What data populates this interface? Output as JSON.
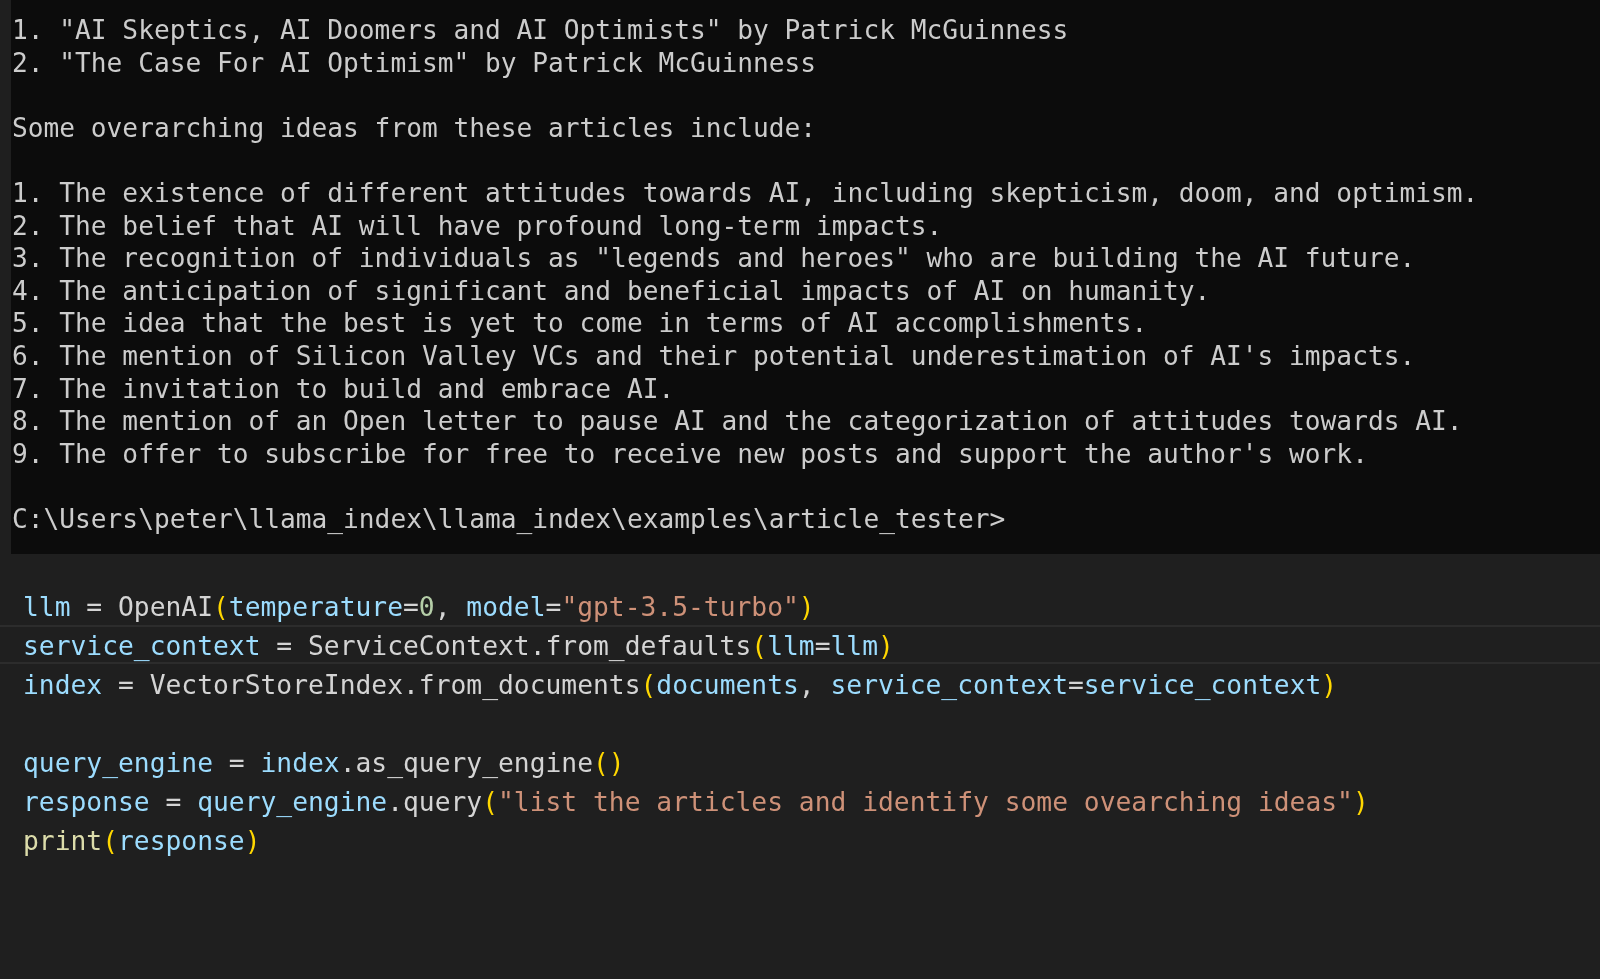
{
  "terminal": {
    "paragraphs": [
      {
        "lines": [
          "1. \"AI Skeptics, AI Doomers and AI Optimists\" by Patrick McGuinness",
          "2. \"The Case For AI Optimism\" by Patrick McGuinness"
        ]
      },
      {
        "lines": [
          "Some overarching ideas from these articles include:"
        ]
      },
      {
        "lines": [
          "1. The existence of different attitudes towards AI, including skepticism, doom, and optimism.",
          "2. The belief that AI will have profound long-term impacts.",
          "3. The recognition of individuals as \"legends and heroes\" who are building the AI future.",
          "4. The anticipation of significant and beneficial impacts of AI on humanity.",
          "5. The idea that the best is yet to come in terms of AI accomplishments.",
          "6. The mention of Silicon Valley VCs and their potential underestimation of AI's impacts.",
          "7. The invitation to build and embrace AI.",
          "8. The mention of an Open letter to pause AI and the categorization of attitudes towards AI.",
          "9. The offer to subscribe for free to receive new posts and support the author's work."
        ]
      },
      {
        "lines": [
          "C:\\Users\\peter\\llama_index\\llama_index\\examples\\article_tester>"
        ]
      }
    ]
  },
  "editor": {
    "blocks": [
      {
        "lines": [
          {
            "current": false,
            "tokens": [
              {
                "kind": "var",
                "text": "llm"
              },
              {
                "kind": "op",
                "text": " = "
              },
              {
                "kind": "plain",
                "text": "OpenAI"
              },
              {
                "kind": "paren",
                "text": "("
              },
              {
                "kind": "var",
                "text": "temperature"
              },
              {
                "kind": "op",
                "text": "="
              },
              {
                "kind": "num",
                "text": "0"
              },
              {
                "kind": "op",
                "text": ", "
              },
              {
                "kind": "var",
                "text": "model"
              },
              {
                "kind": "op",
                "text": "="
              },
              {
                "kind": "str",
                "text": "\"gpt-3.5-turbo\""
              },
              {
                "kind": "paren",
                "text": ")"
              }
            ]
          },
          {
            "current": true,
            "tokens": [
              {
                "kind": "var",
                "text": "service_context"
              },
              {
                "kind": "op",
                "text": " = "
              },
              {
                "kind": "plain",
                "text": "ServiceContext.from_defaults"
              },
              {
                "kind": "paren",
                "text": "("
              },
              {
                "kind": "var",
                "text": "llm"
              },
              {
                "kind": "op",
                "text": "="
              },
              {
                "kind": "var",
                "text": "llm"
              },
              {
                "kind": "paren",
                "text": ")"
              }
            ]
          },
          {
            "current": false,
            "tokens": [
              {
                "kind": "var",
                "text": "index"
              },
              {
                "kind": "op",
                "text": " = "
              },
              {
                "kind": "plain",
                "text": "VectorStoreIndex.from_documents"
              },
              {
                "kind": "paren",
                "text": "("
              },
              {
                "kind": "var",
                "text": "documents"
              },
              {
                "kind": "op",
                "text": ", "
              },
              {
                "kind": "var",
                "text": "service_context"
              },
              {
                "kind": "op",
                "text": "="
              },
              {
                "kind": "var",
                "text": "service_context"
              },
              {
                "kind": "paren",
                "text": ")"
              }
            ]
          }
        ]
      },
      {
        "lines": [
          {
            "current": false,
            "tokens": [
              {
                "kind": "var",
                "text": "query_engine"
              },
              {
                "kind": "op",
                "text": " = "
              },
              {
                "kind": "var",
                "text": "index"
              },
              {
                "kind": "plain",
                "text": ".as_query_engine"
              },
              {
                "kind": "paren",
                "text": "()"
              }
            ]
          },
          {
            "current": false,
            "tokens": [
              {
                "kind": "var",
                "text": "response"
              },
              {
                "kind": "op",
                "text": " = "
              },
              {
                "kind": "var",
                "text": "query_engine"
              },
              {
                "kind": "plain",
                "text": ".query"
              },
              {
                "kind": "paren",
                "text": "("
              },
              {
                "kind": "str",
                "text": "\"list the articles and identify some ovearching ideas\""
              },
              {
                "kind": "paren",
                "text": ")"
              }
            ]
          },
          {
            "current": false,
            "tokens": [
              {
                "kind": "func",
                "text": "print"
              },
              {
                "kind": "paren",
                "text": "("
              },
              {
                "kind": "var",
                "text": "response"
              },
              {
                "kind": "paren",
                "text": ")"
              }
            ]
          }
        ]
      }
    ]
  }
}
